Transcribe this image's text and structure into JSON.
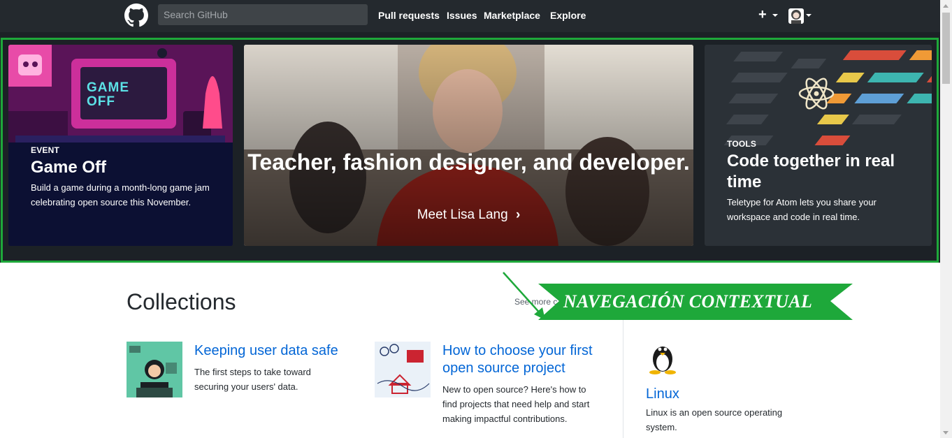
{
  "header": {
    "search_placeholder": "Search GitHub",
    "nav": [
      "Pull requests",
      "Issues",
      "Marketplace",
      "Explore"
    ],
    "plus_label": "+"
  },
  "hero": {
    "left": {
      "eyebrow": "EVENT",
      "title": "Game Off",
      "text": "Build a game during a month-long game jam celebrating open source this November.",
      "art_text": "GAME OFF"
    },
    "middle": {
      "title": "Teacher, fashion designer, and developer.",
      "link": "Meet Lisa Lang",
      "chevron": "›"
    },
    "right": {
      "eyebrow": "TOOLS",
      "title": "Code together in real time",
      "text": "Teletype for Atom lets you share your workspace and code in real time."
    }
  },
  "collections": {
    "heading": "Collections",
    "see_more": "See more c",
    "items": [
      {
        "title": "Keeping user data safe",
        "text": "The first steps to take toward securing your users' data."
      },
      {
        "title": "How to choose your first open source project",
        "text": "New to open source? Here's how to find projects that need help and start making impactful contributions."
      }
    ],
    "topic": {
      "title": "Linux",
      "text": "Linux is an open source operating system."
    }
  },
  "annotation": {
    "label": "NAVEGACIÓN CONTEXTUAL",
    "color": "#1ea83a"
  },
  "colors": {
    "header_bg": "#24292e",
    "link_blue": "#0366d6",
    "highlight_green": "#1ea83a"
  }
}
